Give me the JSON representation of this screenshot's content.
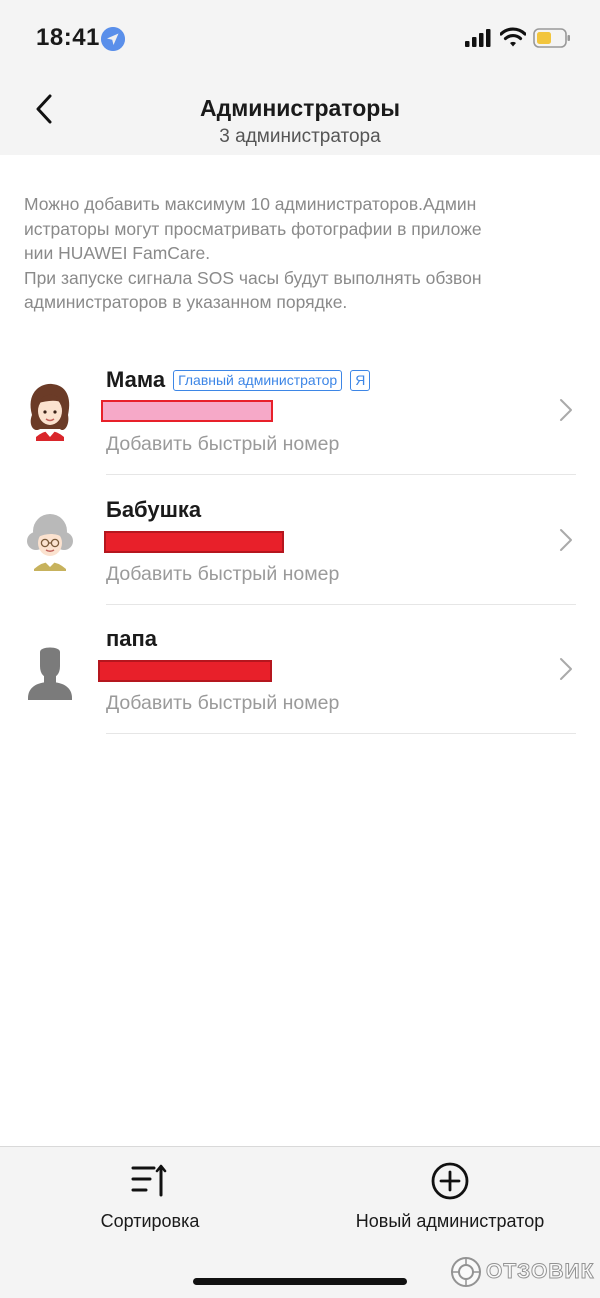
{
  "status_bar": {
    "time": "18:41"
  },
  "header": {
    "back_icon": "chevron-left-icon",
    "title": "Администраторы",
    "subtitle": "3 администратора"
  },
  "info": {
    "line1": "Можно добавить максимум 10 администраторов.Админ",
    "line2": "истраторы могут просматривать фотографии в приложе",
    "line3": "нии HUAWEI FamCare.",
    "line4": "При запуске сигнала SOS часы будут выполнять обзвон",
    "line5": "администраторов в указанном порядке."
  },
  "admins": [
    {
      "name": "Мама",
      "tag_main": "Главный администратор",
      "tag_me": "Я",
      "quick_number": "Добавить быстрый номер",
      "avatar": "woman-avatar-icon",
      "redact_color": "#f6a9c8"
    },
    {
      "name": "Бабушка",
      "quick_number": "Добавить быстрый номер",
      "avatar": "grandma-avatar-icon",
      "redact_color": "#e8202a"
    },
    {
      "name": "папа",
      "quick_number": "Добавить быстрый номер",
      "avatar": "person-silhouette-icon",
      "redact_color": "#e8202a"
    }
  ],
  "bottom_bar": {
    "sort_label": "Сортировка",
    "sort_icon": "sort-icon",
    "add_label": "Новый администратор",
    "add_icon": "plus-circle-icon"
  },
  "watermark": {
    "text": "ОТЗОВИК"
  },
  "colors": {
    "accent": "#3d86e6",
    "background_gray": "#f4f4f4"
  }
}
